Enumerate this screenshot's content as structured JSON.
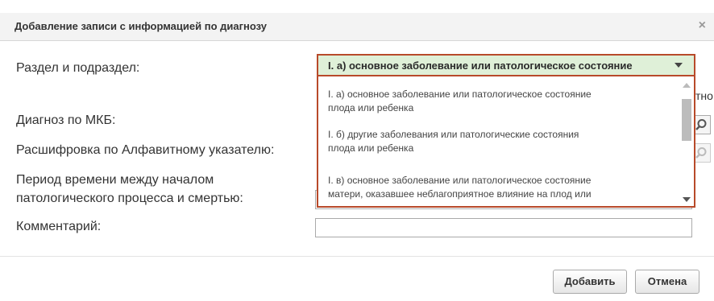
{
  "dialog": {
    "title": "Добавление записи с информацией по диагнозу",
    "close_icon": "×"
  },
  "form": {
    "section_label": "Раздел и подраздел:",
    "section_value": "I. а) основное заболевание или патологическое состояние",
    "diagnosis_label": "Диагноз по МКБ:",
    "alphabet_label": "Расшифровка по Алфавитному указателю:",
    "period_label_line1": "Период времени между началом",
    "period_label_line2": "патологического процесса и смертью:",
    "comment_label": "Комментарий:",
    "comment_value": "",
    "partial_text": "тно"
  },
  "dropdown": {
    "options": [
      {
        "line1": "I. а) основное заболевание или патологическое состояние",
        "line2": "плода или ребенка"
      },
      {
        "line1": "I. б) другие заболевания или патологические состояния",
        "line2": "плода или ребенка"
      },
      {
        "line1": "I. в) основное заболевание или патологическое состояние",
        "line2": "матери, оказавшее неблагоприятное влияние на плод или"
      }
    ]
  },
  "buttons": {
    "add": "Добавить",
    "cancel": "Отмена"
  },
  "colors": {
    "accent_border": "#b84a2a",
    "selected_bg": "#dff0d8"
  },
  "icons": [
    "close-icon",
    "chevron-down-icon",
    "search-icon",
    "scroll-up-icon",
    "scroll-down-icon"
  ]
}
